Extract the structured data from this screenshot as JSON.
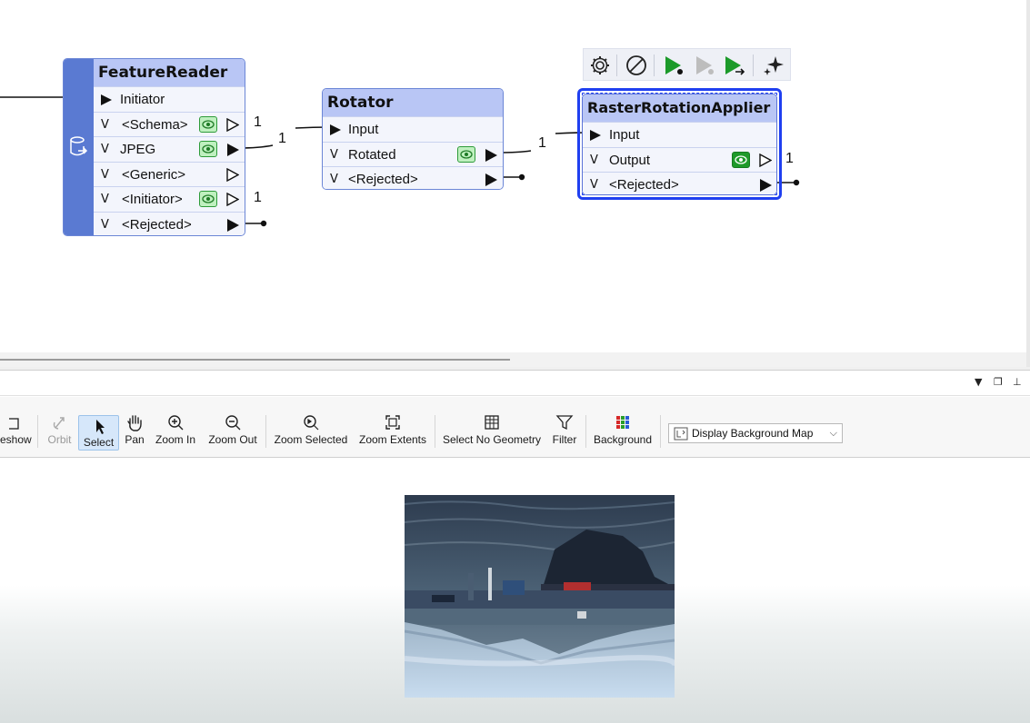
{
  "workspace": {
    "nodes": {
      "feature_reader": {
        "title": "FeatureReader",
        "ports": [
          "Initiator",
          "<Schema>",
          "JPEG",
          "<Generic>",
          "<Initiator>",
          "<Rejected>"
        ]
      },
      "rotator": {
        "title": "Rotator",
        "ports": [
          "Input",
          "Rotated",
          "<Rejected>"
        ]
      },
      "raster_rotation_applier": {
        "title": "RasterRotationApplier",
        "ports": [
          "Input",
          "Output",
          "<Rejected>"
        ]
      }
    },
    "connection_counts": {
      "schema": "1",
      "jpeg_to_rotator": "1",
      "initiator": "1",
      "rotated_to_applier": "1",
      "output": "1"
    }
  },
  "viewer": {
    "toolbar": {
      "slideshow": "eshow",
      "orbit": "Orbit",
      "select": "Select",
      "pan": "Pan",
      "zoom_in": "Zoom In",
      "zoom_out": "Zoom Out",
      "zoom_selected": "Zoom Selected",
      "zoom_extents": "Zoom Extents",
      "select_no_geometry": "Select No Geometry",
      "filter": "Filter",
      "background": "Background"
    },
    "background_map": {
      "selected": "Display Background Map"
    }
  },
  "colors": {
    "node_header": "#b9c6f5",
    "node_body": "#e9eefc",
    "reader_sidebar": "#5a7ad2",
    "selection": "#1f3ff0",
    "eye_green": "#1f9a2a"
  }
}
